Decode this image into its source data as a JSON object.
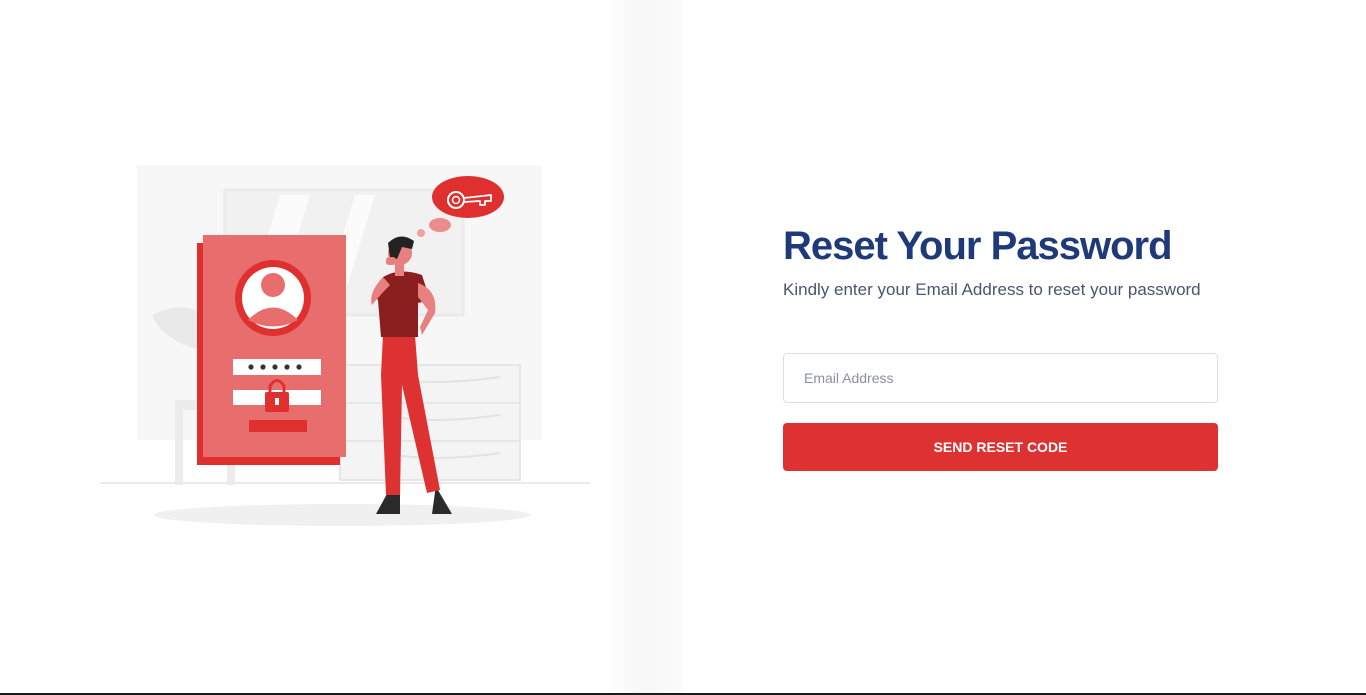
{
  "reset_form": {
    "title": "Reset Your Password",
    "subtitle": "Kindly enter your Email Address to reset your password",
    "email_placeholder": "Email Address",
    "email_value": "",
    "submit_label": "SEND RESET CODE"
  },
  "colors": {
    "accent": "#de3232",
    "title": "#1f3a78",
    "subtitle": "#4b5472"
  },
  "illustration": {
    "password_mask": "●●●●●",
    "icons": [
      "user-avatar-icon",
      "padlock-icon",
      "key-icon"
    ]
  }
}
